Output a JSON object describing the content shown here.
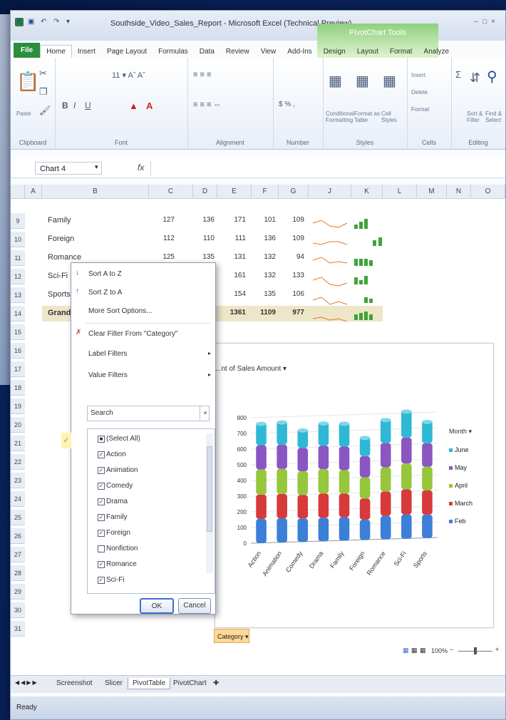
{
  "window": {
    "title": "Southside_Video_Sales_Report - Microsoft Excel (Technical Preview)",
    "context_tab_group": "PivotChart Tools"
  },
  "ribbon_tabs": [
    "File",
    "Home",
    "Insert",
    "Page Layout",
    "Formulas",
    "Data",
    "Review",
    "View",
    "Add-Ins",
    "Design",
    "Layout",
    "Format",
    "Analyze"
  ],
  "ribbon_groups": {
    "clipboard": "Clipboard",
    "font": "Font",
    "alignment": "Alignment",
    "number": "Number",
    "styles": "Styles",
    "cells": "Cells",
    "editing": "Editing"
  },
  "ribbon_buttons": {
    "paste": "Paste",
    "conditional": "Conditional Formatting",
    "format_table": "Format as Table",
    "cell_styles": "Cell Styles",
    "insert": "Insert",
    "delete": "Delete",
    "format": "Format",
    "sort_filter": "Sort & Filter",
    "find_select": "Find & Select"
  },
  "formula_bar": {
    "name_box": "Chart 4",
    "fx": "fx",
    "value": ""
  },
  "columns": [
    "A",
    "B",
    "C",
    "D",
    "E",
    "F",
    "G",
    "J",
    "K",
    "L",
    "M",
    "N",
    "O"
  ],
  "rows": [
    {
      "num": "9",
      "label": "Family",
      "v": [
        "127",
        "136",
        "171",
        "101",
        "109"
      ]
    },
    {
      "num": "10",
      "label": "Foreign",
      "v": [
        "112",
        "110",
        "111",
        "136",
        "109"
      ]
    },
    {
      "num": "11",
      "label": "Romance",
      "v": [
        "125",
        "135",
        "131",
        "132",
        "94"
      ]
    },
    {
      "num": "12",
      "label": "Sci-Fi",
      "v": [
        "",
        "",
        "161",
        "132",
        "133"
      ]
    },
    {
      "num": "13",
      "label": "Sports",
      "v": [
        "",
        "",
        "154",
        "135",
        "106"
      ]
    },
    {
      "num": "14",
      "label": "Grand Total",
      "v": [
        "",
        "",
        "1361",
        "1109",
        "977"
      ]
    }
  ],
  "empty_rows": [
    "15",
    "16",
    "17",
    "18",
    "19",
    "20",
    "21",
    "22",
    "23",
    "24",
    "25",
    "26",
    "27",
    "28",
    "29",
    "30",
    "31"
  ],
  "filter_menu": {
    "sort_az": "Sort A to Z",
    "sort_za": "Sort Z to A",
    "more_sort": "More Sort Options...",
    "clear_filter": "Clear Filter From \"Category\"",
    "label_filters": "Label Filters",
    "value_filters": "Value Filters",
    "search_placeholder": "Search",
    "items": [
      {
        "label": "(Select All)",
        "checked": "partial"
      },
      {
        "label": "Action",
        "checked": true
      },
      {
        "label": "Animation",
        "checked": true
      },
      {
        "label": "Comedy",
        "checked": true
      },
      {
        "label": "Drama",
        "checked": true
      },
      {
        "label": "Family",
        "checked": true
      },
      {
        "label": "Foreign",
        "checked": true
      },
      {
        "label": "Nonfiction",
        "checked": false
      },
      {
        "label": "Romance",
        "checked": true
      },
      {
        "label": "Sci-Fi",
        "checked": true
      }
    ],
    "ok": "OK",
    "cancel": "Cancel"
  },
  "chart": {
    "field_button": "...nt of Sales Amount",
    "category_button": "Category",
    "legend_title": "Month",
    "legend": [
      {
        "name": "June",
        "color": "#2fb8d6"
      },
      {
        "name": "May",
        "color": "#8a56c2"
      },
      {
        "name": "April",
        "color": "#96c63c"
      },
      {
        "name": "March",
        "color": "#d8393b"
      },
      {
        "name": "Feb",
        "color": "#3b7fd8"
      }
    ]
  },
  "chart_data": {
    "type": "bar",
    "stacked": true,
    "categories": [
      "Action",
      "Animation",
      "Comedy",
      "Drama",
      "Family",
      "Foreign",
      "Romance",
      "Sci-Fi",
      "Sports"
    ],
    "series": [
      {
        "name": "Feb",
        "values": [
          155,
          155,
          150,
          150,
          150,
          130,
          150,
          155,
          150
        ]
      },
      {
        "name": "March",
        "values": [
          155,
          155,
          150,
          155,
          150,
          135,
          155,
          160,
          155
        ]
      },
      {
        "name": "April",
        "values": [
          160,
          160,
          150,
          155,
          150,
          135,
          155,
          165,
          150
        ]
      },
      {
        "name": "May",
        "values": [
          155,
          155,
          150,
          150,
          150,
          135,
          155,
          165,
          150
        ]
      },
      {
        "name": "June",
        "values": [
          145,
          150,
          120,
          150,
          155,
          125,
          155,
          175,
          145
        ]
      }
    ],
    "ylim": [
      0,
      800
    ],
    "yticks": [
      "0",
      "100",
      "200",
      "300",
      "400",
      "500",
      "600",
      "700",
      "800"
    ]
  },
  "sheet_tabs": [
    "Screenshot",
    "Slicer",
    "PivotTable",
    "PivotChart"
  ],
  "active_sheet": "PivotTable",
  "status": "Ready",
  "zoom": "100%",
  "zoom_minus": "−",
  "zoom_plus": "+",
  "colors": {
    "accent": "#2a8f3d",
    "pivot": "#8fd07e"
  }
}
